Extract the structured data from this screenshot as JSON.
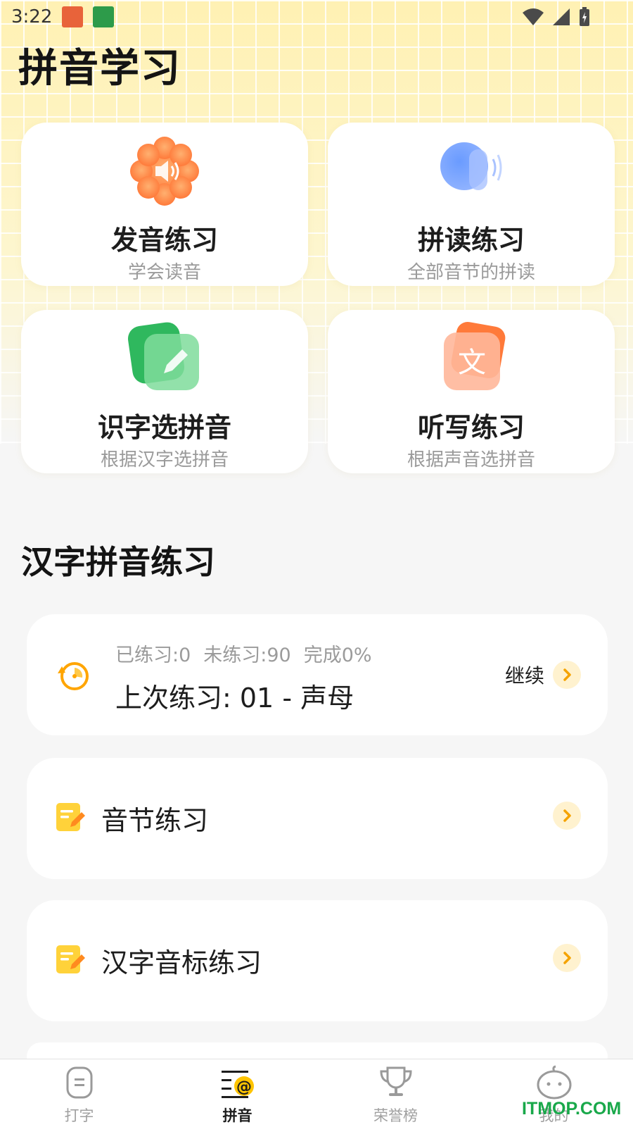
{
  "status_bar": {
    "time": "3:22"
  },
  "page_title": "拼音学习",
  "feature_cards": [
    {
      "title": "发音练习",
      "subtitle": "学会读音",
      "icon": "speaker-icon",
      "color": "#ff8a4a"
    },
    {
      "title": "拼读练习",
      "subtitle": "全部音节的拼读",
      "icon": "sound-wave-icon",
      "color": "#5b8cff"
    },
    {
      "title": "识字选拼音",
      "subtitle": "根据汉字选拼音",
      "icon": "pencil-icon",
      "color": "#3dc46a"
    },
    {
      "title": "听写练习",
      "subtitle": "根据声音选拼音",
      "icon": "text-icon",
      "color": "#ff8a55"
    }
  ],
  "section_title": "汉字拼音练习",
  "resume": {
    "practiced": "已练习:0",
    "unpracticed": "未练习:90",
    "completion": "完成0%",
    "last_practice": "上次练习: 01 - 声母",
    "continue_label": "继续"
  },
  "practice_list": [
    {
      "label": "音节练习",
      "icon": "note-edit-icon"
    },
    {
      "label": "汉字音标练习",
      "icon": "note-edit-icon"
    }
  ],
  "tabs": [
    {
      "label": "打字",
      "icon": "typing-icon",
      "active": false
    },
    {
      "label": "拼音",
      "icon": "pinyin-icon",
      "active": true
    },
    {
      "label": "荣誉榜",
      "icon": "trophy-icon",
      "active": false
    },
    {
      "label": "我的",
      "icon": "profile-icon",
      "active": false
    }
  ],
  "watermark": "ITMOP.COM",
  "colors": {
    "accent": "#f5b800",
    "chevron_bg": "#fff2cf",
    "hero_bg": "#fdf4c4"
  }
}
